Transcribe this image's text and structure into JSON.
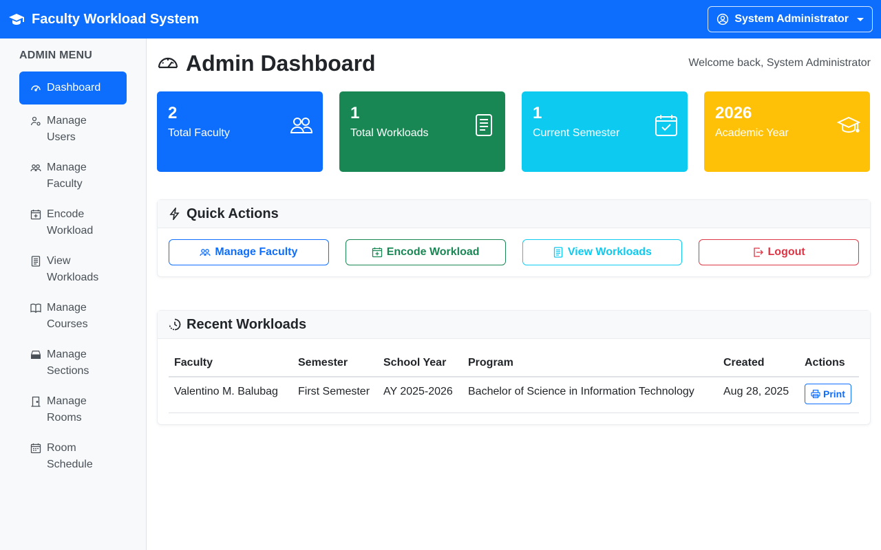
{
  "app": {
    "brand": "Faculty Workload System",
    "user_label": "System Administrator"
  },
  "sidebar": {
    "title": "ADMIN MENU",
    "items": [
      {
        "label": "Dashboard",
        "icon": "speedometer-icon",
        "active": true
      },
      {
        "label": "Manage Users",
        "icon": "user-gear-icon"
      },
      {
        "label": "Manage Faculty",
        "icon": "people-icon"
      },
      {
        "label": "Encode Workload",
        "icon": "calendar-plus-icon"
      },
      {
        "label": "View Workloads",
        "icon": "document-icon"
      },
      {
        "label": "Manage Courses",
        "icon": "book-icon"
      },
      {
        "label": "Manage Sections",
        "icon": "inbox-icon"
      },
      {
        "label": "Manage Rooms",
        "icon": "door-icon"
      },
      {
        "label": "Room Schedule",
        "icon": "calendar-week-icon"
      }
    ]
  },
  "header": {
    "title": "Admin Dashboard",
    "welcome": "Welcome back, System Administrator"
  },
  "stats": [
    {
      "value": "2",
      "label": "Total Faculty",
      "color": "#0d6efd",
      "icon": "people-icon"
    },
    {
      "value": "1",
      "label": "Total Workloads",
      "color": "#198754",
      "icon": "document-icon"
    },
    {
      "value": "1",
      "label": "Current Semester",
      "color": "#0dcaf0",
      "icon": "calendar-check-icon"
    },
    {
      "value": "2026",
      "label": "Academic Year",
      "color": "#ffc107",
      "icon": "mortarboard-icon"
    }
  ],
  "quick_actions": {
    "title": "Quick Actions",
    "buttons": [
      {
        "label": "Manage Faculty",
        "style": "blue",
        "icon": "people-icon"
      },
      {
        "label": "Encode Workload",
        "style": "green",
        "icon": "calendar-plus-icon"
      },
      {
        "label": "View Workloads",
        "style": "cyan",
        "icon": "document-icon"
      },
      {
        "label": "Logout",
        "style": "red",
        "icon": "logout-icon"
      }
    ]
  },
  "recent": {
    "title": "Recent Workloads",
    "columns": [
      "Faculty",
      "Semester",
      "School Year",
      "Program",
      "Created",
      "Actions"
    ],
    "rows": [
      {
        "faculty": "Valentino M. Balubag",
        "semester": "First Semester",
        "school_year": "AY 2025-2026",
        "program": "Bachelor of Science in Information Technology",
        "created": "Aug 28, 2025",
        "action": "Print"
      }
    ]
  }
}
